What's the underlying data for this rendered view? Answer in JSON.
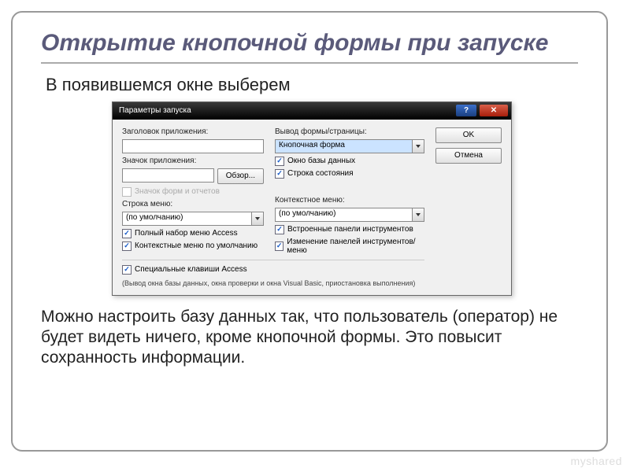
{
  "slide": {
    "title": "Открытие кнопочной формы при запуске",
    "intro": "В появившемся окне выберем",
    "outro": "Можно настроить базу данных так, что пользователь (оператор) не будет видеть ничего, кроме кнопочной формы. Это повысит сохранность информации.",
    "watermark": "myshared"
  },
  "dialog": {
    "title": "Параметры запуска",
    "buttons": {
      "ok": "OK",
      "cancel": "Отмена"
    },
    "left": {
      "app_title_label": "Заголовок приложения:",
      "app_title_value": "",
      "app_icon_label": "Значок приложения:",
      "app_icon_value": "",
      "browse": "Обзор...",
      "form_report_icon": "Значок форм и отчетов",
      "menu_bar_label": "Строка меню:",
      "menu_bar_value": "(по умолчанию)",
      "full_menus": "Полный набор меню Access",
      "shortcut_menus": "Контекстные меню по умолчанию"
    },
    "right": {
      "display_form_label": "Вывод формы/страницы:",
      "display_form_value": "Кнопочная форма",
      "db_window": "Окно базы данных",
      "status_bar": "Строка состояния",
      "shortcut_menu_label": "Контекстное меню:",
      "shortcut_menu_value": "(по умолчанию)",
      "toolbars": "Встроенные панели инструментов",
      "toolbar_changes": "Изменение панелей инструментов/меню"
    },
    "bottom": {
      "special_keys": "Специальные клавиши Access",
      "note": "(Вывод окна базы данных, окна проверки и окна Visual Basic, приостановка выполнения)"
    }
  }
}
